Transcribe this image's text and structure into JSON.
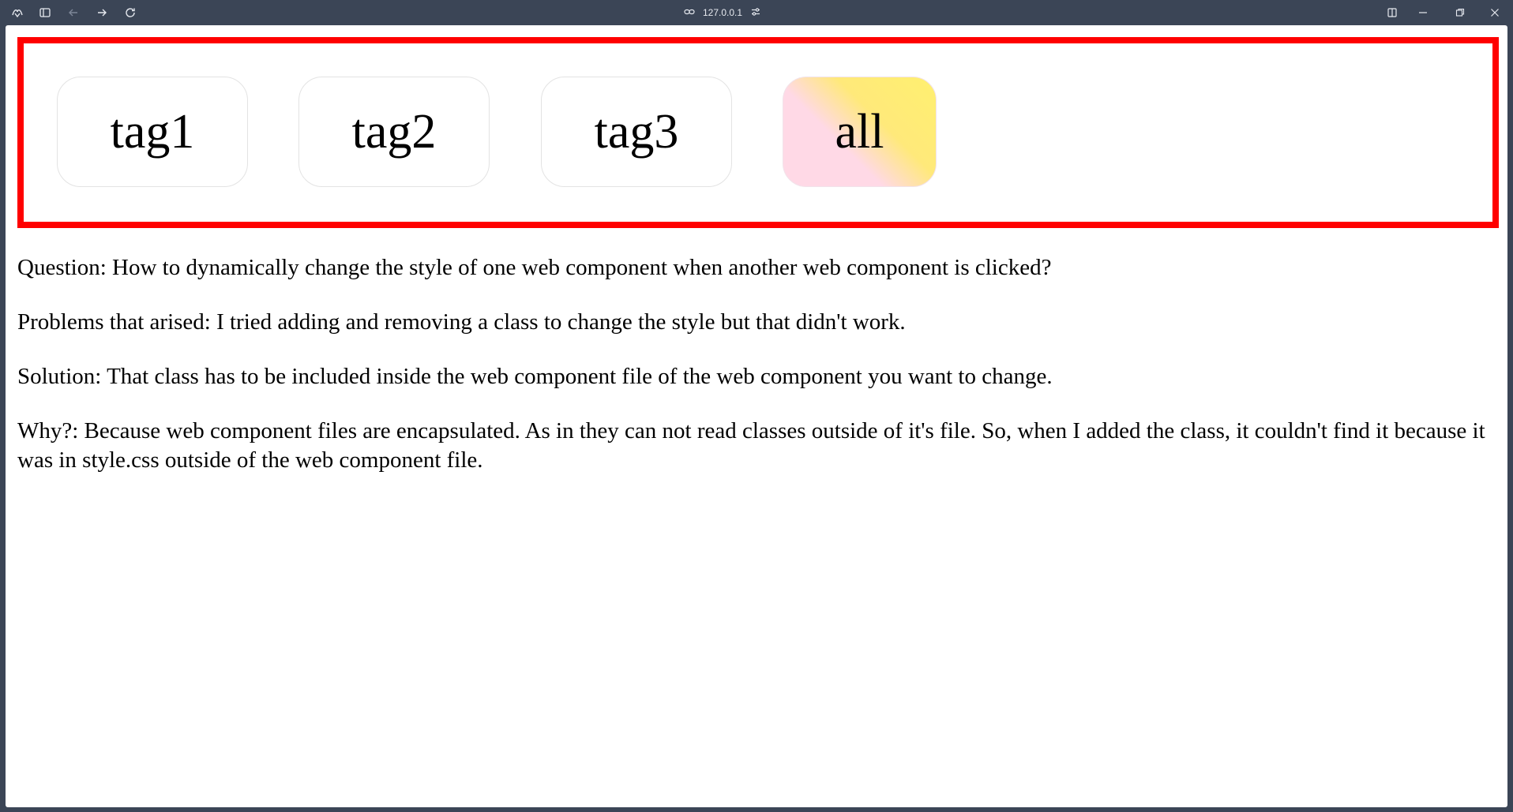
{
  "browser": {
    "address": "127.0.0.1",
    "icons": {
      "logo": "browser-logo-icon",
      "sidebar": "sidebar-toggle-icon",
      "back": "back-arrow-icon",
      "forward": "forward-arrow-icon",
      "reload": "reload-icon",
      "link": "link-icon",
      "site_settings": "site-settings-icon",
      "split": "split-view-icon",
      "minimize": "minimize-icon",
      "restore": "restore-icon",
      "close": "close-icon"
    }
  },
  "tags": [
    {
      "label": "tag1",
      "active": false
    },
    {
      "label": "tag2",
      "active": false
    },
    {
      "label": "tag3",
      "active": false
    },
    {
      "label": "all",
      "active": true
    }
  ],
  "colors": {
    "border": "#ff0000",
    "active_gradient_start": "#ffd9e6",
    "active_gradient_end": "#fff070",
    "chrome": "#3b4556"
  },
  "paragraphs": {
    "question": "Question: How to dynamically change the style of one web component when another web component is clicked?",
    "problems": "Problems that arised: I tried adding and removing a class to change the style but that didn't work.",
    "solution": "Solution: That class has to be included inside the web component file of the web component you want to change.",
    "why": "Why?: Because web component files are encapsulated. As in they can not read classes outside of it's file. So, when I added the class, it couldn't find it because it was in style.css outside of the web component file."
  }
}
